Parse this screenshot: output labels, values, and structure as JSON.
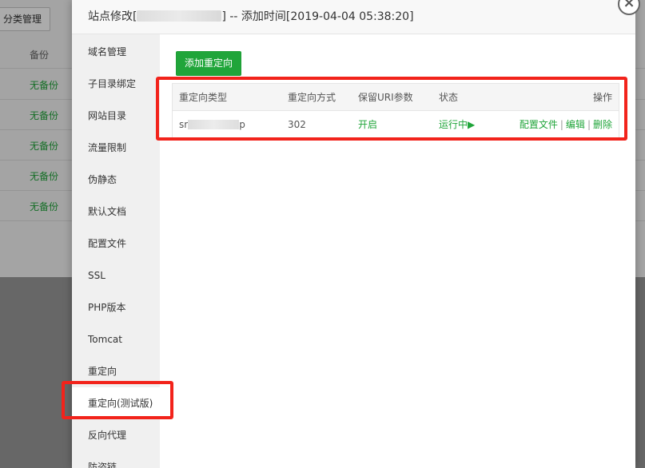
{
  "background": {
    "button_label": "分类管理",
    "header_label": "备份",
    "rows": [
      "无备份",
      "无备份",
      "无备份",
      "无备份",
      "无备份"
    ]
  },
  "dialog": {
    "title_prefix": "站点修改[",
    "title_suffix": "] -- 添加时间[2019-04-04 05:38:20]",
    "close_symbol": "×"
  },
  "sidebar": {
    "items": [
      {
        "label": "域名管理"
      },
      {
        "label": "子目录绑定"
      },
      {
        "label": "网站目录"
      },
      {
        "label": "流量限制"
      },
      {
        "label": "伪静态"
      },
      {
        "label": "默认文档"
      },
      {
        "label": "配置文件"
      },
      {
        "label": "SSL"
      },
      {
        "label": "PHP版本"
      },
      {
        "label": "Tomcat"
      },
      {
        "label": "重定向"
      },
      {
        "label": "重定向(测试版)"
      },
      {
        "label": "反向代理"
      },
      {
        "label": "防盗链"
      }
    ]
  },
  "content": {
    "add_button": "添加重定向",
    "table": {
      "headers": {
        "type": "重定向类型",
        "method": "重定向方式",
        "keep_uri": "保留URI参数",
        "status": "状态",
        "ops": "操作"
      },
      "row": {
        "type_prefix": "sr",
        "type_suffix": "p",
        "method": "302",
        "keep_uri": "开启",
        "status": "运行中▶",
        "op_config": "配置文件",
        "op_edit": "编辑",
        "op_delete": "删除",
        "separator": "|"
      }
    }
  },
  "colors": {
    "accent": "#20a53a",
    "highlight": "#f2231b"
  }
}
